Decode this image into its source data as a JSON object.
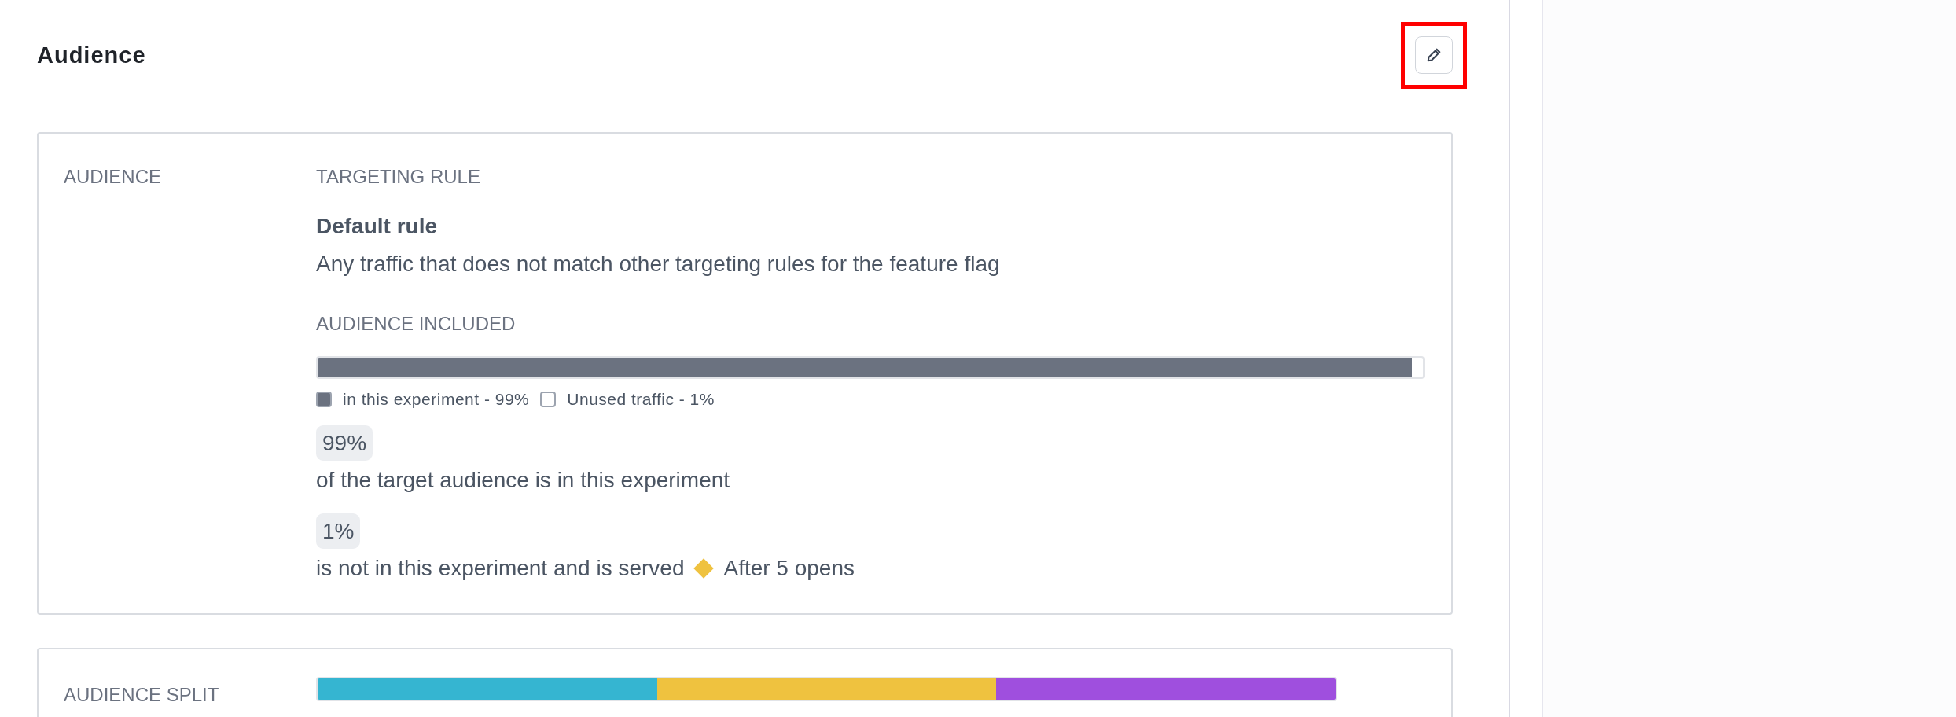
{
  "header": {
    "title": "Audience",
    "edit_button": {
      "highlighted": true
    }
  },
  "audience_card": {
    "label": "AUDIENCE",
    "targeting_heading": "TARGETING RULE",
    "rule_name": "Default rule",
    "rule_description": "Any traffic that does not match other targeting rules for the feature flag",
    "included_heading": "AUDIENCE INCLUDED",
    "included_bar": {
      "level": 0.99
    },
    "legend": [
      {
        "label": "in this experiment - 99%",
        "filled": true
      },
      {
        "label": "Unused traffic - 1%",
        "filled": false
      }
    ],
    "stats": [
      {
        "badge": "99%",
        "text": "of the target audience is in this experiment"
      },
      {
        "badge": "1%",
        "text": "is not in this experiment and is served",
        "variant": "After 5 opens",
        "color": "#efc23f"
      }
    ]
  },
  "split_card": {
    "label": "AUDIENCE SPLIT",
    "segments": [
      {
        "color": "#35b5d1"
      },
      {
        "color": "#efc23f"
      },
      {
        "color": "#9f4fde"
      }
    ]
  }
}
